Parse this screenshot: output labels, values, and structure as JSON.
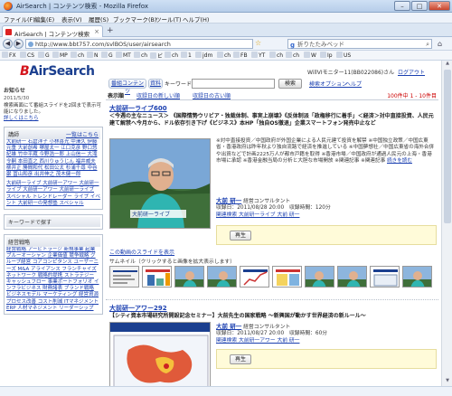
{
  "window": {
    "title": "AirSearch | コンテンツ検索 - Mozilla Firefox",
    "min": "–",
    "max": "□",
    "close": "✕"
  },
  "menu": [
    "ファイル(F)",
    "編集(E)",
    "表示(V)",
    "履歴(S)",
    "ブックマーク(B)",
    "ツール(T)",
    "ヘルプ(H)"
  ],
  "tab": {
    "label": "AirSearch | コンテンツ検索",
    "close": "×",
    "new": "+"
  },
  "nav": {
    "back": "◀",
    "forward": "▶",
    "url": "http://www.bbt757.com/svlBOS/user/airsearch",
    "search_placeholder": "折りたたみベッド",
    "search_engine_icon": "google-icon"
  },
  "bookmarks": [
    "FX",
    "CS",
    "G",
    "MP",
    "ch",
    "N",
    "G",
    "MT",
    "ch",
    "ビ",
    "ch",
    "1",
    "jdm",
    "ch",
    "FB",
    "YT",
    "ch",
    "ch",
    "W",
    "Ip",
    "US"
  ],
  "header": {
    "logo_prefix": "B",
    "logo_text": "AirSearch",
    "user": "WillVIモニター11(BB022086)さん",
    "logout": "ログアウト"
  },
  "mainnav": {
    "tab1": "番組コンテンツ",
    "tab2": "資料",
    "keyword_label": "キーワード",
    "keyword_value": "",
    "search_button": "検索",
    "advanced": "検索オプション",
    "help": "ヘルプ"
  },
  "sidebar": {
    "notice_title": "お知らせ",
    "notice_date": "2011/5/30",
    "notice_text": "検索画面にて番組スライドを2回まで表示可能になりました。",
    "notice_more": "詳しくはこちら",
    "lecturers_title": "講師",
    "lecturers_more": "一覧はこちら",
    "lecturers": "大前研一 石倉洋子 小林喜光 中澤久 伊藤元重 大前創希 堺屋太一 江口克彦 野口悠紀雄 竹中平蔵 今野浩一郎 上山信一 大滝令嗣 本田直之 西川りゅうじん 福井威夫 柳井正 勝間和代 松田公太 杉浦千尋 中谷巌 冨山和彦 出井伸之 茂木健一郎",
    "series": "大前研一ライブ 大前研一アワー 大前研一ライブ 大前研一アワー 大前研一ライブ スペシャル トレンドレーダー ライブ イベント 大前研一の発想塾 スペシャル",
    "keyword_title": "キーワードで探す",
    "sector_title": "経営戦略",
    "sector_links": "経営戦略 アービトラージ 新規事業 起業 ブルーオーシャン 企業価値 競争戦略 グループ経営 コアコンピタンス ユーザーニーズ M&A アライアンス フランチャイズ ネットワーク 戦略的提携 ストラテジー キャッシュフロー 事業ポートフォリオ インフラビジネス 財務諸表 ブランド戦略 ビジネスモデル マーケティング 経営資源 プロセス改善 コスト削減 ITマネジメント ERP 人材マネジメント リーダーシップ"
  },
  "content": {
    "tab_all": "表示順",
    "tab_new": "収録日の新しい順",
    "tab_old": "収録日の古い順",
    "count": "100件中 1 - 10件目",
    "items": [
      {
        "title": "大前研一ライブ600",
        "subtitle": "＜今週の主なニュース＞ 《国際情勢ウリビア・独裁体制、事実上崩壊》《反体制派「政権移行に着手」＜経済＞対中直接投資、人民元建て解禁へ今月から、ドル依存引き下げ《ビジネス》本HP「独自OS徹退」企業スマートフォン発売中止など",
        "desc": "※対中直接投資／中国政府が外国企業による人民元建て投資を解禁 ※中国独立政策／中国広東省・香港政府は昨年秋より独自流路で経済を推進している ※中国夢想社／中国広東省の海外合併や出資などで計画2225万人が都市戸籍を取得 ※香港市場／中国政府が通過人民元の上海・香港市場に承認 ※香港金融当局の分析と大胆な市場開放 ※関連記事 ※関連記事",
        "desc_link": "続きを読む",
        "lecturer": "大前 研一",
        "lecturer_role": "経営コンサルタント",
        "date_line": "収録日：2011/08/28 20:00　収録時間：120分",
        "related": "関連検索 大前研一ライブ 大前 研一",
        "play_button": "再生",
        "slides_link": "この動画のスライドを表示",
        "thumb_caption": "サムネイル（クリックすると画像を拡大表示します）",
        "overlay": "大前研一ライブ"
      },
      {
        "title": "大前研一アワー292",
        "subtitle": "【シティ資本市場研究所開設記念セミナー】大前先生の国家戦略 〜新興国が動かす世界経済の新ルール〜",
        "lecturer": "大前 研一",
        "lecturer_role": "経営コンサルタント",
        "date_line": "収録日：2011/08/27 20:00　収録時間：60分",
        "related": "関連検索 大前研一アワー 大前 研一",
        "play_button": "再生"
      }
    ]
  },
  "colors": {
    "brand_red": "#d4141c",
    "link_blue": "#1a3fb0",
    "brand_navy": "#1b3f8f"
  }
}
